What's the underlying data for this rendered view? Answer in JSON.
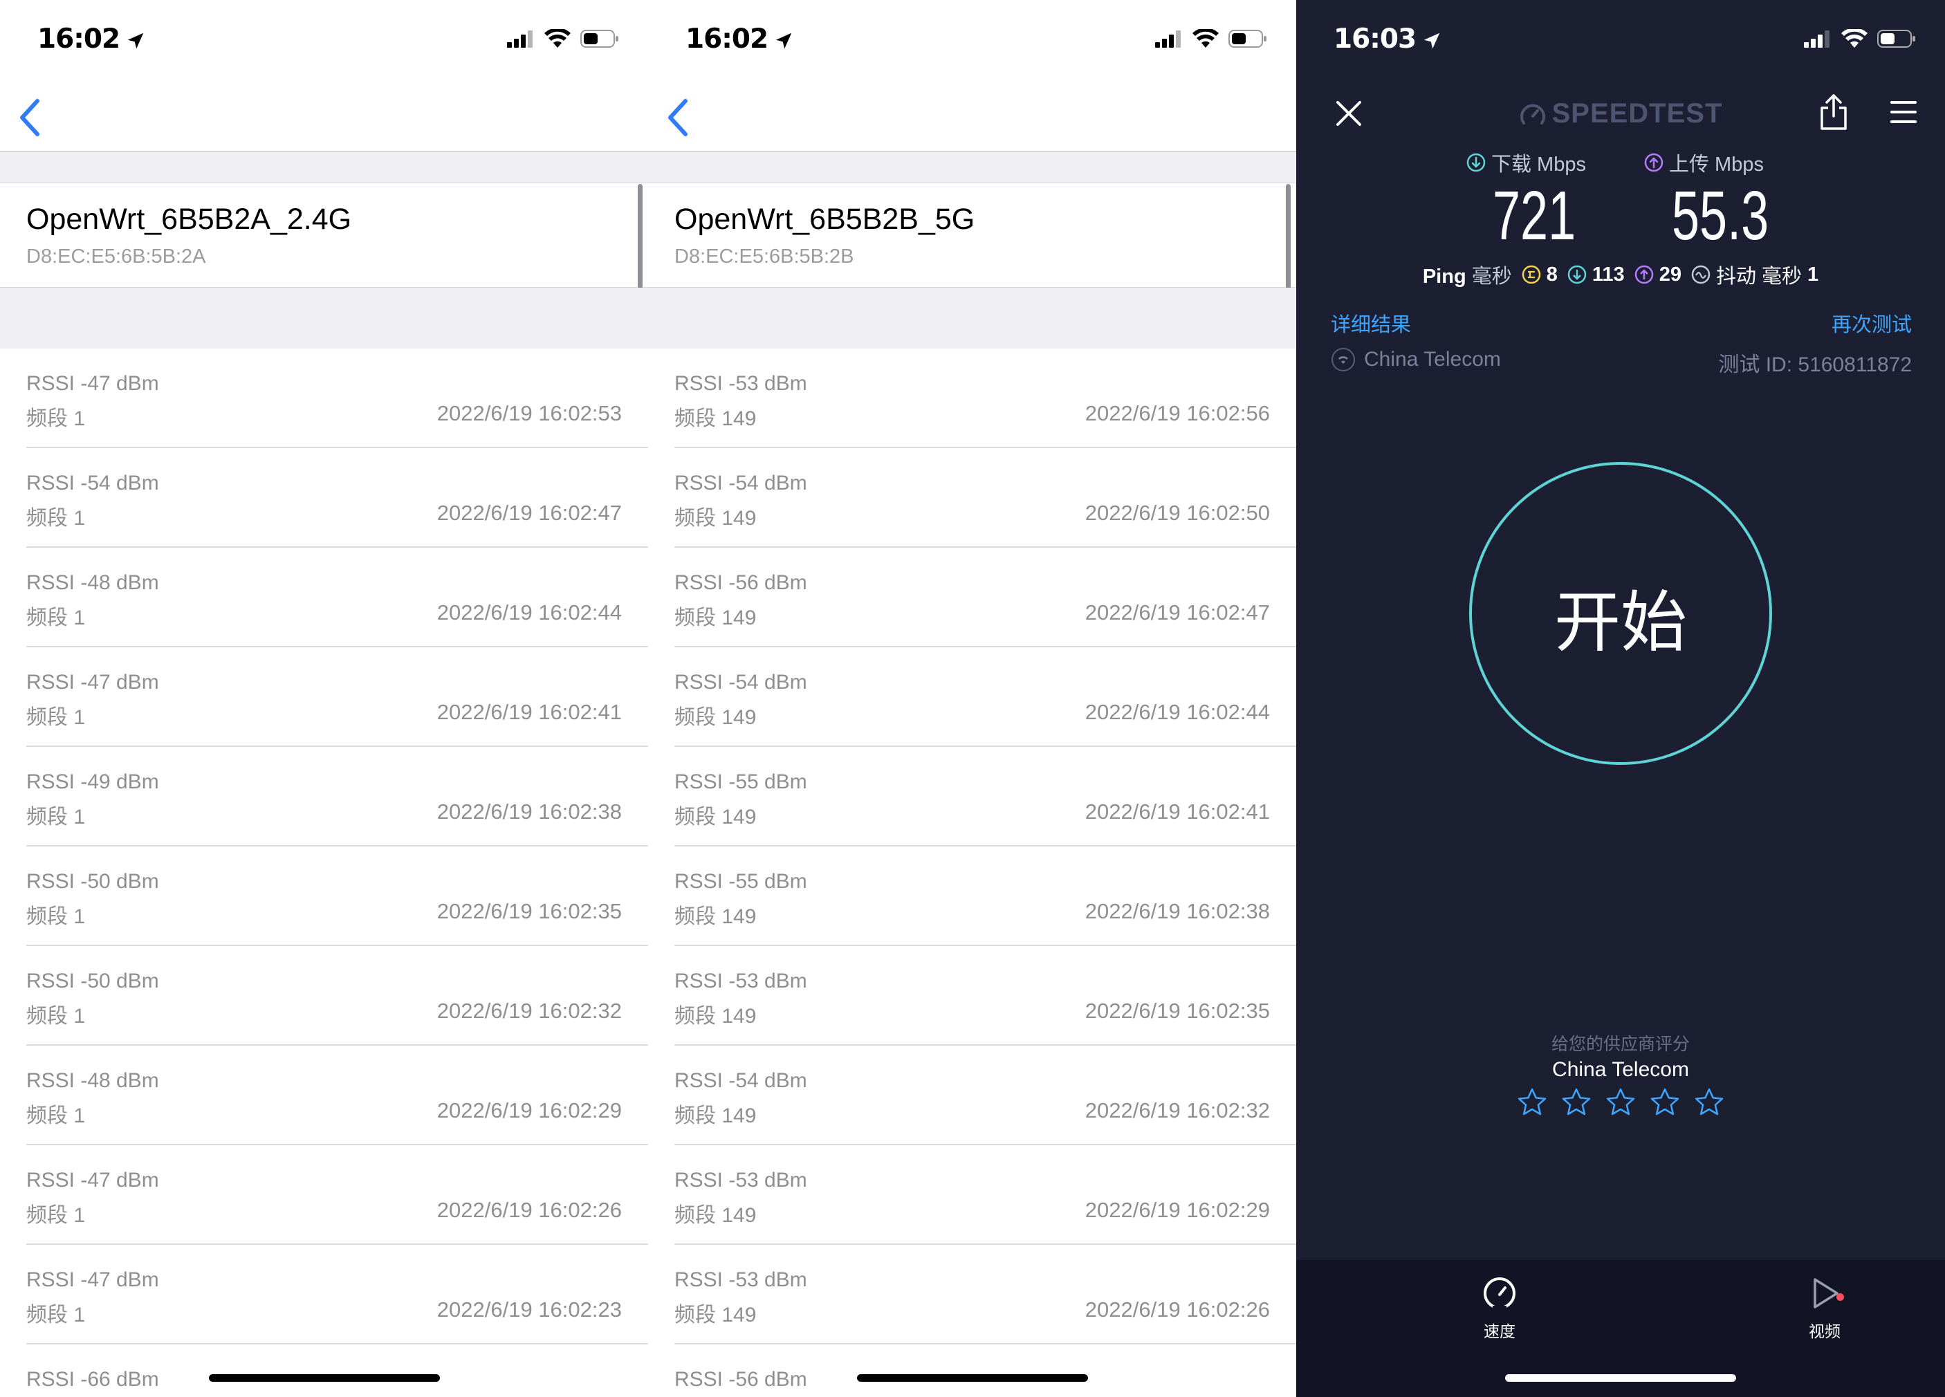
{
  "left_phone": {
    "time": "16:02",
    "network_name": "OpenWrt_6B5B2A_2.4G",
    "mac": "D8:EC:E5:6B:5B:2A",
    "rows": [
      {
        "rssi": "RSSI -47 dBm",
        "band": "频段 1",
        "ts": "2022/6/19 16:02:53"
      },
      {
        "rssi": "RSSI -54 dBm",
        "band": "频段 1",
        "ts": "2022/6/19 16:02:47"
      },
      {
        "rssi": "RSSI -48 dBm",
        "band": "频段 1",
        "ts": "2022/6/19 16:02:44"
      },
      {
        "rssi": "RSSI -47 dBm",
        "band": "频段 1",
        "ts": "2022/6/19 16:02:41"
      },
      {
        "rssi": "RSSI -49 dBm",
        "band": "频段 1",
        "ts": "2022/6/19 16:02:38"
      },
      {
        "rssi": "RSSI -50 dBm",
        "band": "频段 1",
        "ts": "2022/6/19 16:02:35"
      },
      {
        "rssi": "RSSI -50 dBm",
        "band": "频段 1",
        "ts": "2022/6/19 16:02:32"
      },
      {
        "rssi": "RSSI -48 dBm",
        "band": "频段 1",
        "ts": "2022/6/19 16:02:29"
      },
      {
        "rssi": "RSSI -47 dBm",
        "band": "频段 1",
        "ts": "2022/6/19 16:02:26"
      },
      {
        "rssi": "RSSI -47 dBm",
        "band": "频段 1",
        "ts": "2022/6/19 16:02:23"
      },
      {
        "rssi": "RSSI -66 dBm",
        "band": "",
        "ts": ""
      }
    ]
  },
  "middle_phone": {
    "time": "16:02",
    "network_name": "OpenWrt_6B5B2B_5G",
    "mac": "D8:EC:E5:6B:5B:2B",
    "rows": [
      {
        "rssi": "RSSI -53 dBm",
        "band": "频段 149",
        "ts": "2022/6/19 16:02:56"
      },
      {
        "rssi": "RSSI -54 dBm",
        "band": "频段 149",
        "ts": "2022/6/19 16:02:50"
      },
      {
        "rssi": "RSSI -56 dBm",
        "band": "频段 149",
        "ts": "2022/6/19 16:02:47"
      },
      {
        "rssi": "RSSI -54 dBm",
        "band": "频段 149",
        "ts": "2022/6/19 16:02:44"
      },
      {
        "rssi": "RSSI -55 dBm",
        "band": "频段 149",
        "ts": "2022/6/19 16:02:41"
      },
      {
        "rssi": "RSSI -55 dBm",
        "band": "频段 149",
        "ts": "2022/6/19 16:02:38"
      },
      {
        "rssi": "RSSI -53 dBm",
        "band": "频段 149",
        "ts": "2022/6/19 16:02:35"
      },
      {
        "rssi": "RSSI -54 dBm",
        "band": "频段 149",
        "ts": "2022/6/19 16:02:32"
      },
      {
        "rssi": "RSSI -53 dBm",
        "band": "频段 149",
        "ts": "2022/6/19 16:02:29"
      },
      {
        "rssi": "RSSI -53 dBm",
        "band": "频段 149",
        "ts": "2022/6/19 16:02:26"
      },
      {
        "rssi": "RSSI -56 dBm",
        "band": "",
        "ts": ""
      }
    ]
  },
  "speedtest": {
    "time": "16:03",
    "logo": "SPEEDTEST",
    "download_label": "下载 Mbps",
    "upload_label": "上传 Mbps",
    "download_value": "721",
    "upload_value": "55.3",
    "ping_label": "Ping",
    "ms_label": "毫秒",
    "ping_idle": "8",
    "ping_down": "113",
    "ping_up": "29",
    "jitter_label": "抖动 毫秒",
    "jitter": "1",
    "detail_link": "详细结果",
    "retest_link": "再次测试",
    "isp": "China Telecom",
    "test_id": "测试 ID: 5160811872",
    "start_button": "开始",
    "rate_label": "给您的供应商评分",
    "rate_isp": "China Telecom",
    "tabs": [
      {
        "label": "速度"
      },
      {
        "label": "视频"
      }
    ],
    "colors": {
      "accent": "#3ea6ff",
      "ring": "#5fd3d6",
      "background": "#1c1f32"
    }
  }
}
